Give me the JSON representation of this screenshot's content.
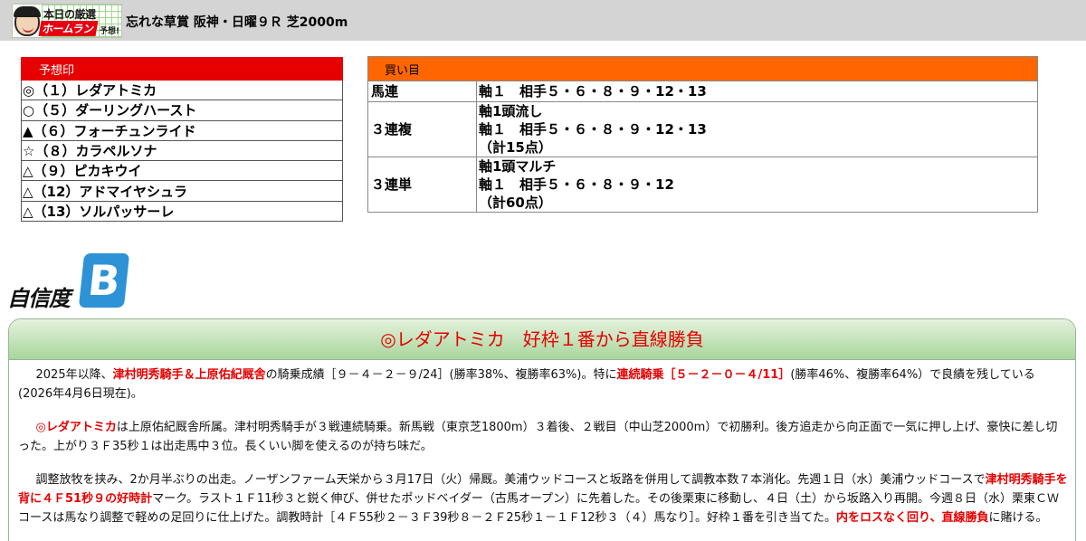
{
  "header": {
    "logo_line1": "本日の厳選",
    "logo_line2": "ホームラン",
    "logo_line3": "予想!",
    "race_title": "忘れな草賞 阪神・日曜９Ｒ 芝2000m"
  },
  "picks": {
    "heading": "予想印",
    "rows": [
      "◎（１）レダアトミカ",
      "○（５）ダーリングハースト",
      "▲（６）フォーチュンライド",
      "☆（８）カラペルソナ",
      "△（９）ピカキウイ",
      "△（12）アドマイヤシュラ",
      "△（13）ソルパッサーレ"
    ]
  },
  "bets": {
    "heading": "買い目",
    "rows": [
      {
        "type": "馬連",
        "lines": [
          "軸１　相手５・６・８・９・12・13"
        ]
      },
      {
        "type": "３連複",
        "lines": [
          "軸1頭流し",
          "軸１　相手５・６・８・９・12・13",
          "（計15点）"
        ]
      },
      {
        "type": "３連単",
        "lines": [
          "軸1頭マルチ",
          "軸１　相手５・６・８・９・12",
          "（計60点）"
        ]
      }
    ]
  },
  "confidence": {
    "label": "自信度",
    "grade": "B"
  },
  "comment": {
    "title": "◎レダアトミカ　好枠１番から直線勝負",
    "p1": {
      "a": "2025年以降、",
      "b": "津村明秀騎手＆上原佑紀厩舎",
      "c": "の騎乗成績［９－４－２－９/24］(勝率38%、複勝率63%)。特に",
      "d": "連続騎乗［５－２－０－４/11］",
      "e": "(勝率46%、複勝率64%）で良績を残している(2026年4月6日現在)。"
    },
    "p2": {
      "a": "◎レダアトミカ",
      "b": "は上原佑紀厩舎所属。津村明秀騎手が３戦連続騎乗。新馬戦（東京芝1800m）３着後、２戦目（中山芝2000m）で初勝利。後方追走から向正面で一気に押し上げ、豪快に差し切った。上がり３Ｆ35秒１は出走馬中３位。長くいい脚を使えるのが持ち味だ。"
    },
    "p3": {
      "a": "調整放牧を挟み、2か月半ぶりの出走。ノーザンファーム天栄から３月17日（火）帰厩。美浦ウッドコースと坂路を併用して調教本数７本消化。先週１日（水）美浦ウッドコースで",
      "b": "津村明秀騎手を背に４Ｆ51秒９の好時計",
      "c": "マーク。ラスト１Ｆ11秒３と鋭く伸び、併せたポッドベイダー（古馬オープン）に先着した。その後栗東に移動し、４日（土）から坂路入り再開。今週８日（水）栗東ＣＷコースは馬なり調整で軽めの足回りに仕上げた。調教時計［４Ｆ55秒２－３Ｆ39秒８－２Ｆ25秒１－１Ｆ12秒３（４）馬なり］。好枠１番を引き当てた。",
      "d": "内をロスなく回り、直線勝負",
      "e": "に賭ける。"
    }
  }
}
